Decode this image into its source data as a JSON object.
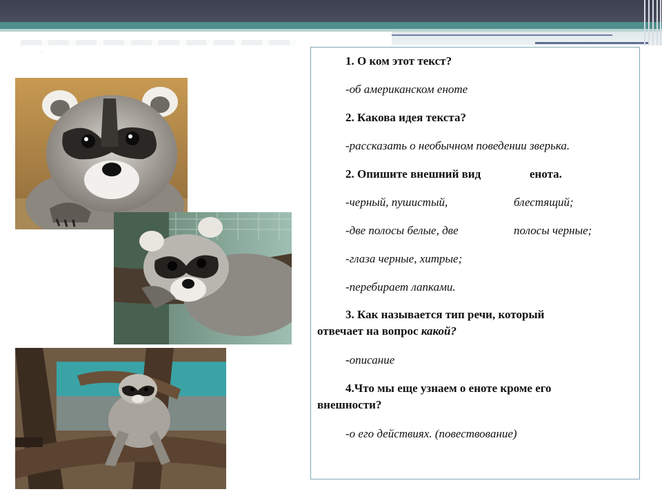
{
  "slide": {
    "caption": "—"
  },
  "panel": {
    "q1": "1. О ком этот текст?",
    "a1": "-об американском еноте",
    "q2": "2. Какова идея текста?",
    "a2": "-рассказать о необычном поведении зверька.",
    "q3_part1": "2. Опишите внешний вид",
    "q3_part2": "енота.",
    "a3_line1_left": "-черный, пушистый,",
    "a3_line1_right": "блестящий;",
    "a3_line2_left": "-две полосы белые, две",
    "a3_line2_right": "полосы черные;",
    "a3_line3": "-глаза черные, хитрые;",
    "a3_line4": "-перебирает лапками.",
    "q4_line1": "3. Как называется тип речи, который",
    "q4_line2_plain": "отвечает на вопрос",
    "q4_line2_italic": "какой?",
    "a4_dash": "-",
    "a4_text": "описание",
    "q5_line1": "4.Что мы еще узнаем о еноте кроме его",
    "q5_line2": "внешности?",
    "a5": "-о его действиях.  (повествование)"
  },
  "photos": [
    {
      "subject": "raccoon-face-closeup"
    },
    {
      "subject": "raccoon-lying-on-branch"
    },
    {
      "subject": "raccoon-climbing-tree"
    }
  ]
}
